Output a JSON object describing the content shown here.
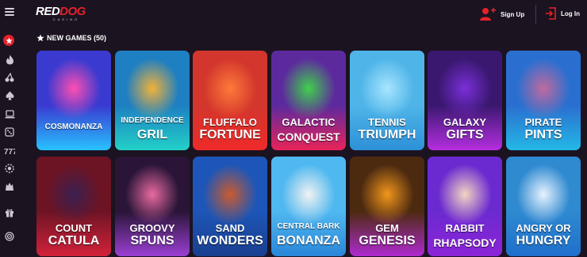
{
  "header": {
    "logo_main_a": "RED",
    "logo_main_b": "DOG",
    "logo_sub": "CASINO",
    "signup_label": "Sign Up",
    "login_label": "Log In"
  },
  "sidebar": {
    "items": [
      {
        "icon": "star-icon",
        "active": true
      },
      {
        "icon": "fire-icon"
      },
      {
        "icon": "cherry-icon"
      },
      {
        "icon": "spade-icon"
      },
      {
        "icon": "laptop-icon"
      },
      {
        "icon": "dice-icon"
      },
      {
        "icon": "sevens-icon"
      },
      {
        "icon": "chip-icon"
      },
      {
        "icon": "wolf-icon"
      },
      {
        "icon": "gift-icon"
      },
      {
        "icon": "target-icon"
      }
    ]
  },
  "section": {
    "title": "NEW GAMES (50)"
  },
  "games": [
    {
      "line1": "COSMONANZA",
      "line2": "",
      "bg": [
        "#3a3ad0",
        "#ff4fb2",
        "#27c3ff"
      ]
    },
    {
      "line1": "INDEPENDENCE",
      "line2": "GRIL",
      "bg": [
        "#1e7fc2",
        "#f2b23a",
        "#22d1c8"
      ]
    },
    {
      "line1": "FLUFFALO",
      "line2": "FORTUNE",
      "bg": [
        "#d2362c",
        "#ff7a3a",
        "#ee2a2a"
      ]
    },
    {
      "line1": "GALACTIC",
      "line2": "CONQUEST",
      "bg": [
        "#5d2a9e",
        "#3fd04c",
        "#e8235a"
      ]
    },
    {
      "line1": "TENNIS",
      "line2": "TRIUMPH",
      "bg": [
        "#4fb5e8",
        "#a8e5ff",
        "#2d90d8"
      ]
    },
    {
      "line1": "GALAXY",
      "line2": "GIFTS",
      "bg": [
        "#3a1870",
        "#7a2fd8",
        "#b52ee0"
      ]
    },
    {
      "line1": "PIRATE",
      "line2": "PINTS",
      "bg": [
        "#2a6fd0",
        "#c06a9e",
        "#24b8e6"
      ]
    },
    {
      "line1": "COUNT",
      "line2": "CATULA",
      "bg": [
        "#6d1424",
        "#3a2050",
        "#d3223b"
      ]
    },
    {
      "line1": "GROOVY",
      "line2": "SPUNS",
      "bg": [
        "#2a1538",
        "#e86aa0",
        "#9b3fd4"
      ]
    },
    {
      "line1": "SAND",
      "line2": "WONDERS",
      "bg": [
        "#1d56b8",
        "#c95b2f",
        "#1a3f8e"
      ]
    },
    {
      "line1": "CENTRAL BARK",
      "line2": "BONANZA",
      "bg": [
        "#4fb8f0",
        "#f2f2f2",
        "#2a86d8"
      ]
    },
    {
      "line1": "GEM",
      "line2": "GENESIS",
      "bg": [
        "#4c2a10",
        "#f2961c",
        "#b02ad0"
      ]
    },
    {
      "line1": "RABBIT",
      "line2": "RHAPSODY",
      "bg": [
        "#6b2ad0",
        "#f2d6c2",
        "#8d24d8"
      ]
    },
    {
      "line1": "ANGRY OR",
      "line2": "HUNGRY",
      "bg": [
        "#2f8ad0",
        "#e8f2ff",
        "#1e6fcb"
      ]
    }
  ]
}
